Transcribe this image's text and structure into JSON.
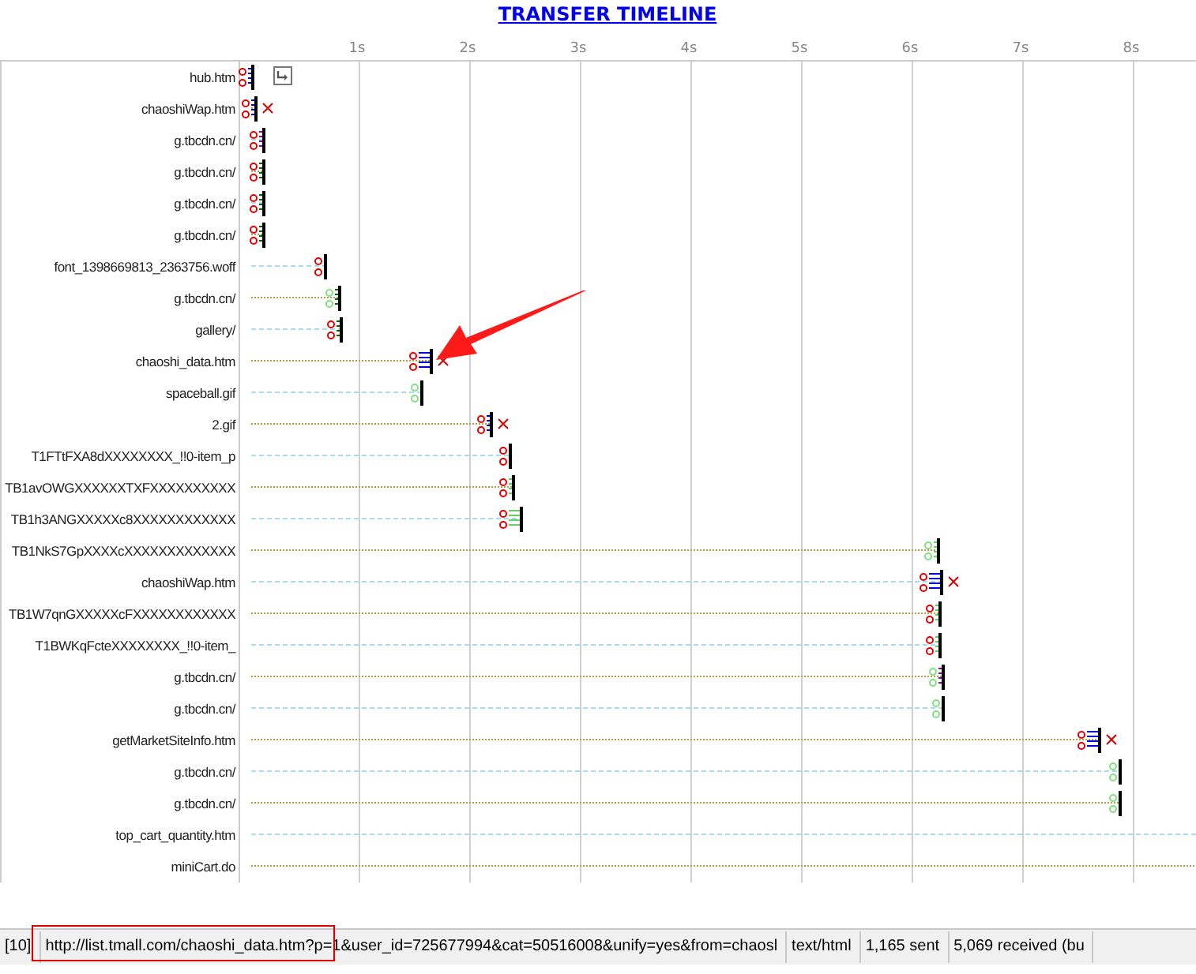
{
  "title": "TRANSFER TIMELINE",
  "ticks": [
    "1s",
    "2s",
    "3s",
    "4s",
    "5s",
    "6s",
    "7s",
    "8s"
  ],
  "rows": [
    {
      "label": "hub.htm",
      "kind": "done",
      "level": 0.003,
      "color": "#e00000",
      "hatch": {
        "kind": "narrow",
        "color": "#0000c0"
      },
      "error": false,
      "has_icon": true
    },
    {
      "label": "chaoshiWap.htm",
      "kind": "done",
      "level": 0.007,
      "color": "#e00000",
      "hatch": {
        "kind": "narrow",
        "color": "#0000c0"
      },
      "error": true,
      "has_icon": false
    },
    {
      "label": "g.tbcdn.cn/",
      "kind": "done",
      "level": 0.015,
      "color": "#e00000",
      "hatch": {
        "kind": "narrow",
        "color": "#990099"
      },
      "error": false,
      "has_icon": false
    },
    {
      "label": "g.tbcdn.cn/",
      "kind": "done",
      "level": 0.015,
      "color": "#e00000",
      "hatch": {
        "kind": "narrow",
        "color": "#006600"
      },
      "error": false,
      "has_icon": false
    },
    {
      "label": "g.tbcdn.cn/",
      "kind": "done",
      "level": 0.015,
      "color": "#e00000",
      "hatch": {
        "kind": "narrow",
        "color": "#006600"
      },
      "error": false,
      "has_icon": false
    },
    {
      "label": "g.tbcdn.cn/",
      "kind": "done",
      "level": 0.015,
      "color": "#e00000",
      "hatch": {
        "kind": "narrow",
        "color": "#006600"
      },
      "error": false,
      "has_icon": false
    },
    {
      "label": "font_1398669813_2363756.woff",
      "kind": "done",
      "level": 0.08,
      "color": "#e00000",
      "error": false,
      "has_icon": false
    },
    {
      "label": "g.tbcdn.cn/",
      "kind": "done",
      "level": 0.095,
      "color": "#80e080",
      "hatch": {
        "kind": "narrow",
        "color": "#006600"
      },
      "error": false,
      "has_icon": false
    },
    {
      "label": "gallery/",
      "kind": "done",
      "level": 0.097,
      "color": "#e00000",
      "hatch": {
        "kind": "narrow",
        "color": "#006600"
      },
      "error": false,
      "has_icon": false
    },
    {
      "label": "chaoshi_data.htm",
      "kind": "done",
      "level": 0.193,
      "color": "#e00000",
      "hatch": {
        "kind": "wide",
        "color": "#0000e0"
      },
      "error": true,
      "has_icon": false
    },
    {
      "label": "spaceball.gif",
      "kind": "done",
      "level": 0.183,
      "color": "#80e080",
      "error": false,
      "has_icon": false
    },
    {
      "label": "2.gif",
      "kind": "done",
      "level": 0.256,
      "color": "#e00000",
      "hatch": {
        "kind": "narrow",
        "color": "#0000c0"
      },
      "error": true,
      "has_icon": false
    },
    {
      "label": "T1FTtFXA8dXXXXXXXX_!!0-item_p",
      "kind": "done",
      "level": 0.276,
      "color": "#e00000",
      "error": false,
      "has_icon": false
    },
    {
      "label": "TB1avOWGXXXXXXTXFXXXXXXXXXX",
      "kind": "done",
      "level": 0.28,
      "color": "#e00000",
      "hatch": {
        "kind": "narrow",
        "color": "#60d060"
      },
      "error": false,
      "has_icon": false
    },
    {
      "label": "TB1h3ANGXXXXXc8XXXXXXXXXXXX",
      "kind": "done",
      "level": 0.288,
      "color": "#e00000",
      "hatch": {
        "kind": "wide",
        "color": "#60d060"
      },
      "error": false,
      "has_icon": false
    },
    {
      "label": "TB1NkS7GpXXXXcXXXXXXXXXXXXX",
      "kind": "done",
      "level": 0.729,
      "color": "#80e080",
      "hatch": {
        "kind": "narrow",
        "color": "#60d060"
      },
      "error": false,
      "has_icon": false
    },
    {
      "label": "chaoshiWap.htm",
      "kind": "done",
      "level": 0.732,
      "color": "#e00000",
      "hatch": {
        "kind": "wide",
        "color": "#0000e0"
      },
      "error": true,
      "has_icon": false
    },
    {
      "label": "TB1W7qnGXXXXXcFXXXXXXXXXXXX",
      "kind": "done",
      "level": 0.73,
      "color": "#e00000",
      "hatch": {
        "kind": "narrow",
        "color": "#60d060"
      },
      "error": false,
      "has_icon": false
    },
    {
      "label": "T1BWKqFcteXXXXXXXX_!!0-item_",
      "kind": "done",
      "level": 0.73,
      "color": "#e00000",
      "hatch": {
        "kind": "narrow",
        "color": "#60d060"
      },
      "error": false,
      "has_icon": false
    },
    {
      "label": "g.tbcdn.cn/",
      "kind": "done",
      "level": 0.734,
      "color": "#80e080",
      "hatch": {
        "kind": "narrow",
        "color": "#990099"
      },
      "error": false,
      "has_icon": false
    },
    {
      "label": "g.tbcdn.cn/",
      "kind": "done",
      "level": 0.734,
      "color": "#80e080",
      "error": false,
      "has_icon": false
    },
    {
      "label": "getMarketSiteInfo.htm",
      "kind": "done",
      "level": 0.9,
      "color": "#e00000",
      "hatch": {
        "kind": "wide",
        "color": "#0000e0"
      },
      "error": true,
      "has_icon": false
    },
    {
      "label": "g.tbcdn.cn/",
      "kind": "done",
      "level": 0.922,
      "color": "#80e080",
      "error": false,
      "has_icon": false
    },
    {
      "label": "g.tbcdn.cn/",
      "kind": "done",
      "level": 0.922,
      "color": "#80e080",
      "error": false,
      "has_icon": false
    },
    {
      "label": "top_cart_quantity.htm",
      "kind": "pending",
      "level": 1
    },
    {
      "label": "miniCart.do",
      "kind": "pending",
      "level": 1
    }
  ],
  "status_bar": [
    "[10]",
    "http://list.tmall.com/chaoshi_data.htm?p=1&user_id=725677994&cat=50516008&unify=yes&from=chaosl",
    "text/html",
    "1,165 sent",
    "5,069 received (bu"
  ]
}
